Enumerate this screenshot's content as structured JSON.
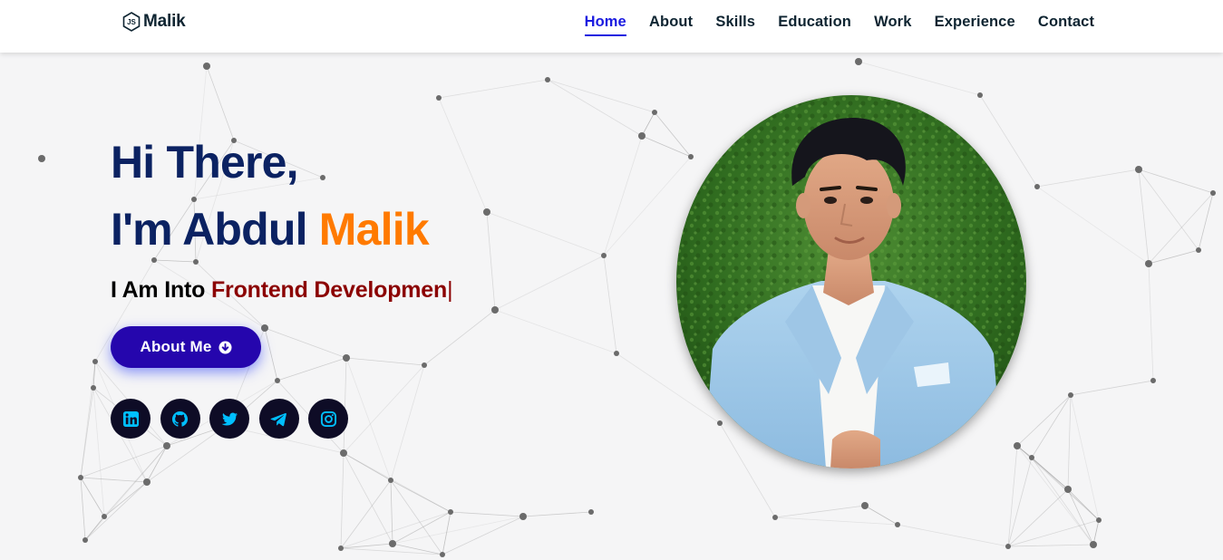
{
  "header": {
    "logo_text": "Malik",
    "logo_icon": "js-logo-icon",
    "nav": [
      {
        "label": "Home",
        "active": true
      },
      {
        "label": "About",
        "active": false
      },
      {
        "label": "Skills",
        "active": false
      },
      {
        "label": "Education",
        "active": false
      },
      {
        "label": "Work",
        "active": false
      },
      {
        "label": "Experience",
        "active": false
      },
      {
        "label": "Contact",
        "active": false
      }
    ]
  },
  "hero": {
    "greeting": "Hi There,",
    "intro_prefix": "I'm Abdul",
    "intro_accent": "Malik",
    "typed_prefix": "I Am Into",
    "typed_text": "Frontend Developmen",
    "cursor": "|",
    "about_button": {
      "label": "About Me",
      "icon": "arrow-circle-down-icon"
    },
    "socials": [
      {
        "icon": "linkedin-icon"
      },
      {
        "icon": "github-icon"
      },
      {
        "icon": "twitter-icon"
      },
      {
        "icon": "telegram-icon"
      },
      {
        "icon": "instagram-icon"
      }
    ],
    "profile_photo": "profile-photo"
  },
  "colors": {
    "brand_dark": "#0b2262",
    "accent_orange": "#ff7a00",
    "typed_red": "#8b0000",
    "button_blue": "#2506ad",
    "nav_active": "#1a1ae0",
    "social_bg": "#0e0c26",
    "social_icon": "#00bfff",
    "page_bg": "#f5f5f6"
  }
}
